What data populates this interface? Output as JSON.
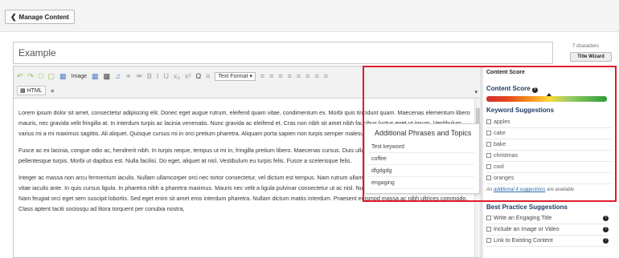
{
  "topbar": {
    "manage_label": "Manage Content"
  },
  "title": {
    "value": "Example",
    "char_count": "7 characters",
    "wizard_label": "Title Wizard"
  },
  "toolbar": {
    "image_label": "Image",
    "text_format": "Text Format",
    "html_label": "HTML"
  },
  "editor": {
    "paragraphs": [
      "Lorem ipsum dolor sit amet, consectetur adipiscing elit. Donec eget augue rutrum, eleifend quam vitae, condimentum ex. Morbi quis tincidunt quam. Maecenas elementum libero mauris, nec gravida velit fringilla at. In interdum turpis ac lacinia venenatis. Nunc gravida ac eleifend et. Cras non nibh sit amet nibh faucibus luctus eget ut ipsum. Vestibulum varius mi a mi maximus sagittis. Ali aliquet. Quisque cursus mi in orci pretium pharetra. Aliquam porta sapien non turpis semper malesuada. In hac habitas quis est vel placerat.",
      "Fusce ac ex lacinia, congue odio ac, hendrerit nibh. In turpis neque, tempus ut mi in, fringilla pretium libero. Maecenas cursus. Duis ullamcorper pulvinar augue a faucibus. Cras at pellentesque turpis. Morbi ut dapibus est. Nulla facilisi. Do eget, aliquet at nisl. Vestibulum eu turpis felis. Fusce a scelerisque felis.",
      "Integer ac massa non arcu fermentum iaculis. Nullam ullamcorper orci nec tortor consectetur, vel dictum est tempus. Nam rutrum ullamcorper tincidunt. Etiam non faucibus nulla, vitae iaculis ante. In quis cursus ligula. In pharetra nibh a pharetra maximus. Mauris nec velit a ligula pulvinar consectetur ut ac nisl. Nullam eget eleifend eros sit amet finibus. Nam feugiat orci eget sem suscipit lobortis. Sed eget enim sit amet eros interdum pharetra. Nullam dictum mattis interdum. Praesent euismod massa ac nibh ultrices commodo. Class aptent taciti sociosqu ad litora torquent per conubia nostra,"
    ]
  },
  "phrases": {
    "title": "Additional Phrases and Topics",
    "items": [
      "Test keyword",
      "coffee",
      "dfgdgdg",
      "engaging"
    ]
  },
  "score": {
    "tab": "Content Score",
    "label": "Content Score",
    "level": 0.52,
    "keywords_title": "Keyword Suggestions",
    "keywords": [
      "apples",
      "cake",
      "bake",
      "christmas",
      "cool",
      "oranges"
    ],
    "additional_prefix": "An",
    "additional_link": "additional 4 suggestions",
    "additional_suffix": "are available",
    "best_practice_title": "Best Practice Suggestions",
    "best_practices": [
      "Write an Engaging Title",
      "Include an Image or Video",
      "Link to Existing Content"
    ]
  },
  "colors": {
    "highlight": "#e01b2c",
    "heading": "#1f3d66"
  }
}
